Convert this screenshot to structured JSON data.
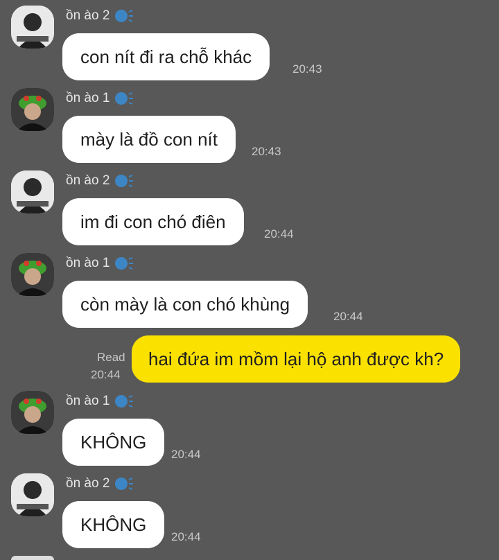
{
  "messages": [
    {
      "sender": "ồn ào 2",
      "text": "con nít đi ra chỗ khác",
      "time": "20:43"
    },
    {
      "sender": "ồn ào 1",
      "text": "mày là đồ con nít",
      "time": "20:43"
    },
    {
      "sender": "ồn ào 2",
      "text": "im đi con chó điên",
      "time": "20:44"
    },
    {
      "sender": "ồn ào 1",
      "text": "còn mày là con chó khùng",
      "time": "20:44"
    },
    {
      "sender": "ồn ào 1",
      "text": "KHÔNG",
      "time": "20:44"
    },
    {
      "sender": "ồn ào 2",
      "text": "KHÔNG",
      "time": "20:44"
    }
  ],
  "my_message": {
    "text": "hai đứa im mồm lại hộ anh được kh?",
    "read": "Read",
    "time": "20:44"
  },
  "colors": {
    "background": "#585858",
    "my_bubble": "#fae100",
    "other_bubble": "#ffffff",
    "speaker_icon": "#3d86c6"
  },
  "icons": {
    "speaker": "speaking-head-icon",
    "avatar_2": "avatar-person-dark-hair-icon",
    "avatar_1": "avatar-person-green-hat-icon"
  }
}
